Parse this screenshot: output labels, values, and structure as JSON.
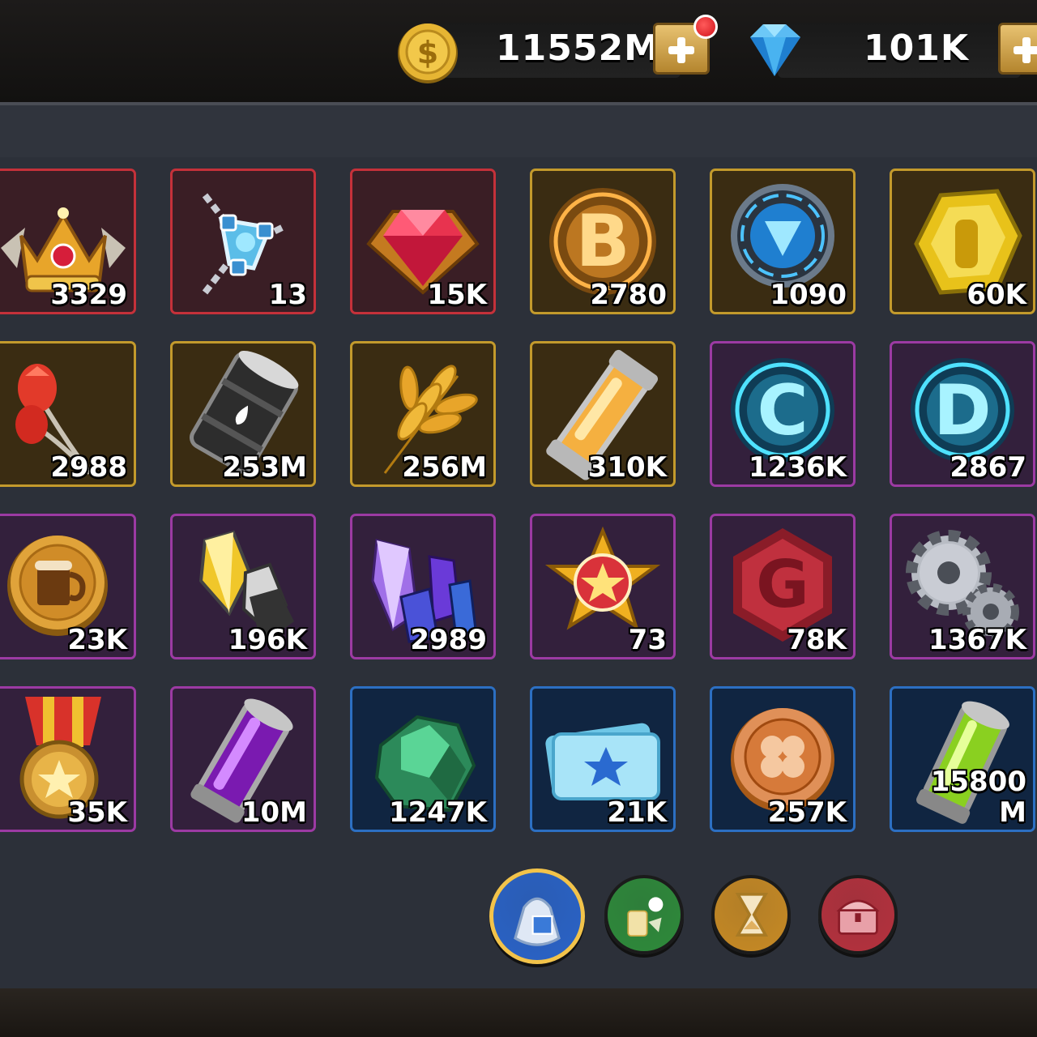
{
  "currency": {
    "gold": {
      "amount": "11552M",
      "icon": "gold-coin-icon"
    },
    "gems": {
      "amount": "101K",
      "icon": "blue-diamond-icon"
    }
  },
  "inventory": [
    {
      "icon": "crown-emblem-icon",
      "rarity": "red",
      "quantity": "3329"
    },
    {
      "icon": "chain-device-icon",
      "rarity": "red",
      "quantity": "13"
    },
    {
      "icon": "ruby-emblem-icon",
      "rarity": "red",
      "quantity": "15K"
    },
    {
      "icon": "bitcoin-b-icon",
      "rarity": "gold",
      "quantity": "2780"
    },
    {
      "icon": "blue-energy-core-icon",
      "rarity": "gold",
      "quantity": "1090"
    },
    {
      "icon": "gold-hex-nugget-icon",
      "rarity": "gold",
      "quantity": "60K"
    },
    {
      "icon": "red-tulip-icon",
      "rarity": "gold",
      "quantity": "2988"
    },
    {
      "icon": "oil-barrel-icon",
      "rarity": "gold",
      "quantity": "253M"
    },
    {
      "icon": "wheat-icon",
      "rarity": "gold",
      "quantity": "256M"
    },
    {
      "icon": "battery-canister-icon",
      "rarity": "gold",
      "quantity": "310K"
    },
    {
      "icon": "cyan-coin-c-icon",
      "rarity": "purple",
      "quantity": "1236K"
    },
    {
      "icon": "cyan-coin-d-icon",
      "rarity": "purple",
      "quantity": "2867"
    },
    {
      "icon": "beer-coin-icon",
      "rarity": "purple",
      "quantity": "23K"
    },
    {
      "icon": "gold-crystal-icon",
      "rarity": "purple",
      "quantity": "196K"
    },
    {
      "icon": "purple-crystal-icon",
      "rarity": "purple",
      "quantity": "2989"
    },
    {
      "icon": "star-badge-icon",
      "rarity": "purple",
      "quantity": "73"
    },
    {
      "icon": "red-g-hexagon-icon",
      "rarity": "purple",
      "quantity": "78K"
    },
    {
      "icon": "gears-icon",
      "rarity": "purple",
      "quantity": "1367K"
    },
    {
      "icon": "medal-icon",
      "rarity": "purple",
      "quantity": "35K"
    },
    {
      "icon": "purple-canister-icon",
      "rarity": "purple",
      "quantity": "10M"
    },
    {
      "icon": "green-ore-icon",
      "rarity": "blue",
      "quantity": "1247K"
    },
    {
      "icon": "blue-ticket-icon",
      "rarity": "blue",
      "quantity": "21K"
    },
    {
      "icon": "clover-coin-icon",
      "rarity": "blue",
      "quantity": "257K"
    },
    {
      "icon": "green-canister-icon",
      "rarity": "blue",
      "quantity": "15800\nM"
    }
  ],
  "tabs": [
    {
      "icon": "resource-bag-icon",
      "color": "#2a63c7",
      "selected": true
    },
    {
      "icon": "food-items-icon",
      "color": "#2e8a3a",
      "selected": false
    },
    {
      "icon": "hourglass-speedup-icon",
      "color": "#c78a24",
      "selected": false
    },
    {
      "icon": "treasure-chest-icon",
      "color": "#b5313d",
      "selected": false
    }
  ]
}
